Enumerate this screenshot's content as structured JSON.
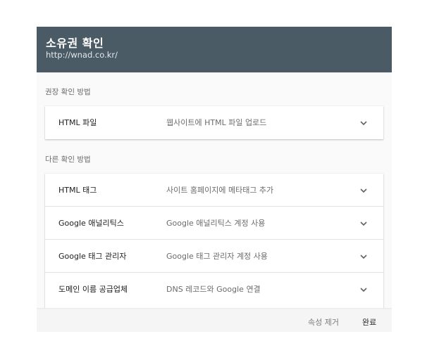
{
  "header": {
    "title": "소유권 확인",
    "url": "http://wnad.co.kr/"
  },
  "recommended": {
    "label": "권장 확인 방법",
    "items": [
      {
        "name": "HTML 파일",
        "desc": "웹사이트에 HTML 파일 업로드"
      }
    ]
  },
  "alternate": {
    "label": "다른 확인 방법",
    "items": [
      {
        "name": "HTML 태그",
        "desc": "사이트 홈페이지에 메타태그 추가"
      },
      {
        "name": "Google 애널리틱스",
        "desc": "Google 애널리틱스 계정 사용"
      },
      {
        "name": "Google 태그 관리자",
        "desc": "Google 태그 관리자 계정 사용"
      },
      {
        "name": "도메인 이름 공급업체",
        "desc": "DNS 레코드와 Google 연결"
      }
    ]
  },
  "footer": {
    "remove_label": "속성 제거",
    "done_label": "완료"
  },
  "icons": {
    "expand": "chevron-down-icon"
  },
  "colors": {
    "header_bg": "#4a5b66",
    "header_text": "#ffffff"
  }
}
